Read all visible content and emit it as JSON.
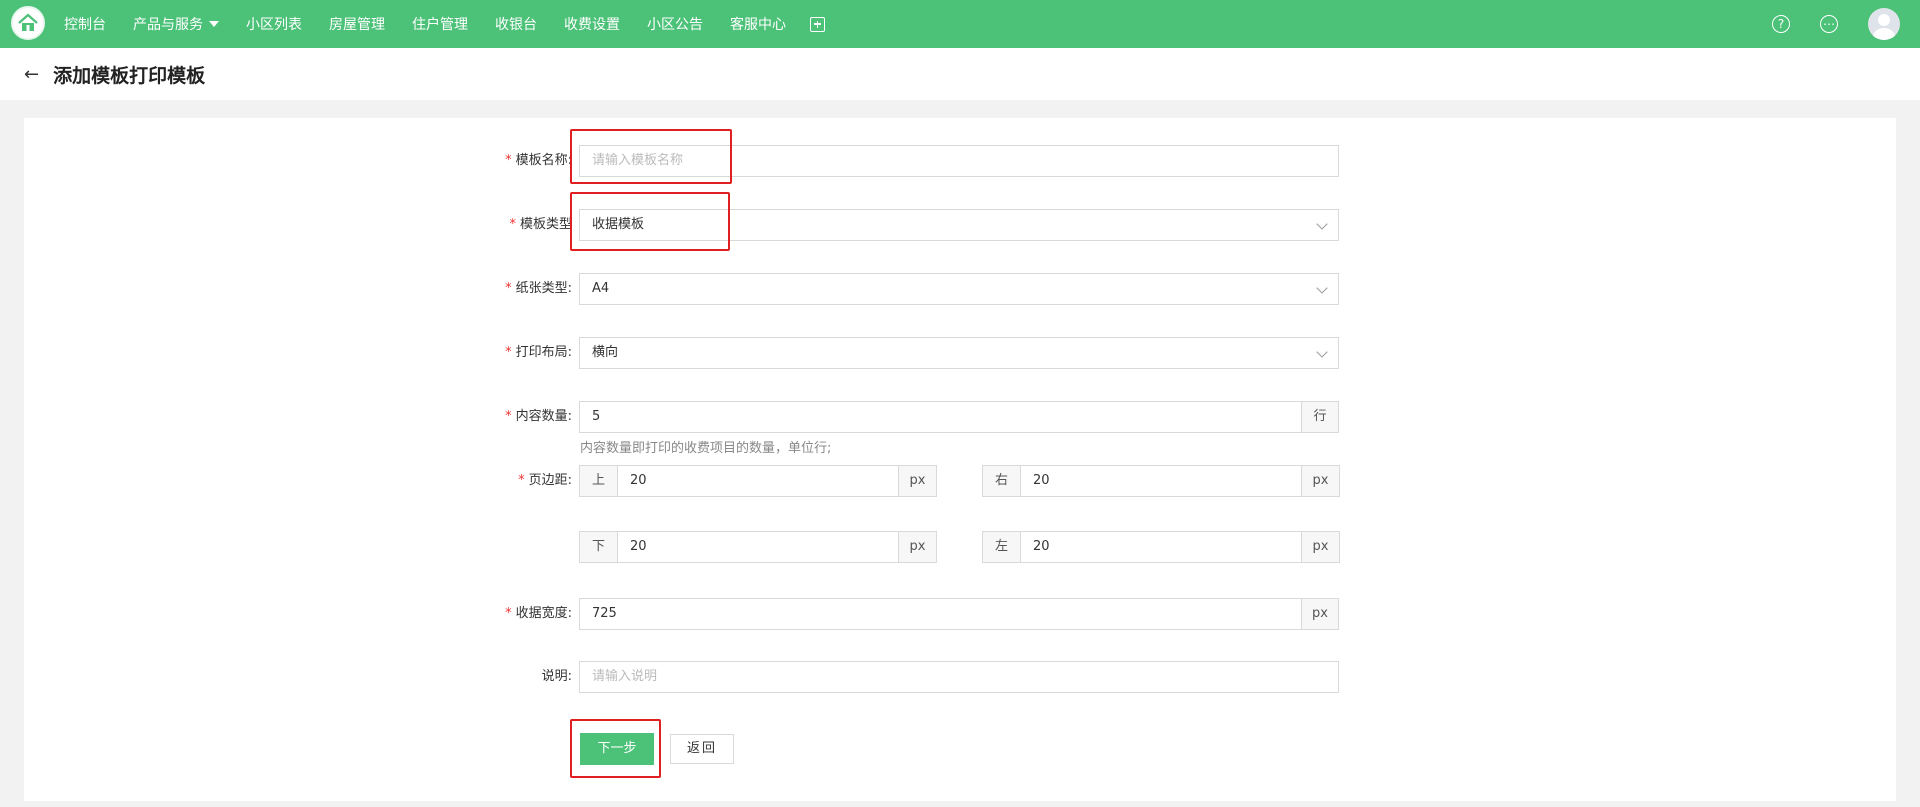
{
  "nav": {
    "items": [
      {
        "label": "控制台"
      },
      {
        "label": "产品与服务"
      },
      {
        "label": "小区列表"
      },
      {
        "label": "房屋管理"
      },
      {
        "label": "住户管理"
      },
      {
        "label": "收银台"
      },
      {
        "label": "收费设置"
      },
      {
        "label": "小区公告"
      },
      {
        "label": "客服中心"
      }
    ],
    "right_icons": [
      "help-icon",
      "chat-icon",
      "avatar"
    ]
  },
  "header": {
    "title": "添加模板打印模板",
    "back_icon": "arrow-left-icon"
  },
  "form": {
    "template_name": {
      "label": "模板名称:",
      "placeholder": "请输入模板名称"
    },
    "template_type": {
      "label": "模板类型",
      "value": "收据模板"
    },
    "paper_type": {
      "label": "纸张类型:",
      "value": "A4"
    },
    "print_layout": {
      "label": "打印布局:",
      "value": "横向"
    },
    "content_count": {
      "label": "内容数量:",
      "value": "5",
      "suffix": "行",
      "hint": "内容数量即打印的收费项目的数量，单位行;"
    },
    "margins": {
      "label": "页边距:",
      "top": {
        "prefix": "上",
        "value": "20",
        "suffix": "px"
      },
      "right": {
        "prefix": "右",
        "value": "20",
        "suffix": "px"
      },
      "bottom": {
        "prefix": "下",
        "value": "20",
        "suffix": "px"
      },
      "left": {
        "prefix": "左",
        "value": "20",
        "suffix": "px"
      }
    },
    "receipt_width": {
      "label": "收据宽度:",
      "value": "725",
      "suffix": "px"
    },
    "description": {
      "label": "说明:",
      "placeholder": "请输入说明"
    },
    "required_mark": "*"
  },
  "buttons": {
    "next": "下一步",
    "back": "返回"
  },
  "colors": {
    "brand": "#4cc279",
    "required": "#e33333",
    "highlight": "#e02020"
  }
}
